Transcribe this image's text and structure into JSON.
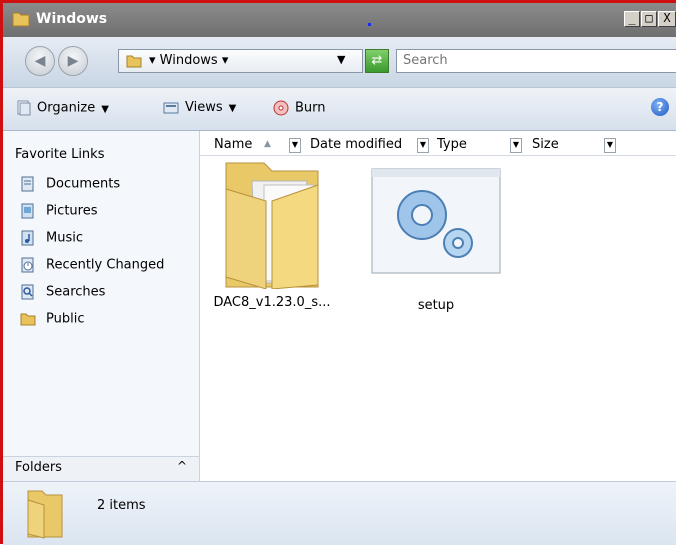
{
  "window": {
    "title": "Windows"
  },
  "window_buttons": {
    "minimize": "_",
    "maximize": "□",
    "close": "X"
  },
  "address": {
    "crumb": "Windows",
    "crumb_arrow": "▾",
    "dropdown": "▼"
  },
  "search": {
    "placeholder": "Search"
  },
  "toolbar": {
    "organize_label": "Organize",
    "views_label": "Views",
    "burn_label": "Burn",
    "help_label": "?"
  },
  "sidebar": {
    "header": "Favorite Links",
    "items": [
      {
        "label": "Documents",
        "icon": "documents-icon"
      },
      {
        "label": "Pictures",
        "icon": "pictures-icon"
      },
      {
        "label": "Music",
        "icon": "music-icon"
      },
      {
        "label": "Recently Changed",
        "icon": "recently-changed-icon"
      },
      {
        "label": "Searches",
        "icon": "searches-icon"
      },
      {
        "label": "Public",
        "icon": "public-folder-icon"
      }
    ],
    "folders_label": "Folders",
    "folders_chevron": "^"
  },
  "columns": {
    "name": "Name",
    "sort_indicator": "▲",
    "date_modified": "Date modified",
    "type": "Type",
    "size": "Size"
  },
  "files": [
    {
      "name": "DAC8_v1.23.0_s...",
      "icon": "folder-icon"
    },
    {
      "name": "setup",
      "icon": "setup-gears-icon"
    }
  ],
  "status": {
    "item_count": "2 items"
  },
  "colors": {
    "title_bar": "#7a7a7a",
    "address_bar": "#d9e3ee",
    "frame_border": "#d01010"
  }
}
